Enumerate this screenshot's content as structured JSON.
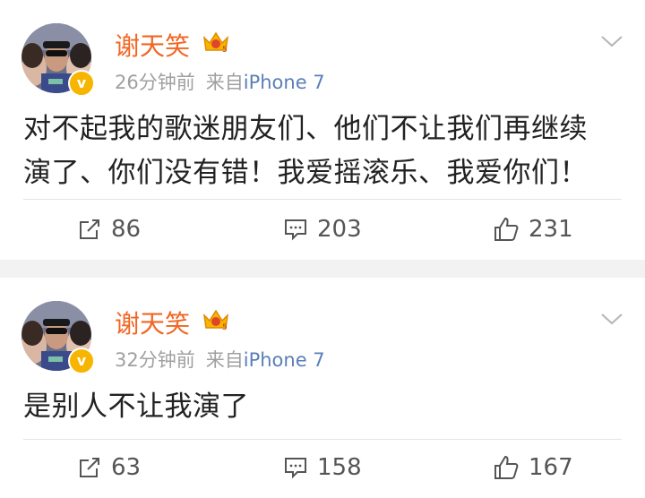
{
  "posts": [
    {
      "user": {
        "name": "谢天笑",
        "verified_badge": "v",
        "crown_badge": "5"
      },
      "time": "26分钟前",
      "source_label": "来自",
      "device": "iPhone 7",
      "text_lines": [
        "对不起我的歌迷朋友们、他们不让我们再继续",
        "演了、你们没有错！我爱摇滚乐、我爱你们！"
      ],
      "actions": {
        "repost": "86",
        "comment": "203",
        "like": "231"
      }
    },
    {
      "user": {
        "name": "谢天笑",
        "verified_badge": "v",
        "crown_badge": "5"
      },
      "time": "32分钟前",
      "source_label": "来自",
      "device": "iPhone 7",
      "text_lines": [
        "是别人不让我演了"
      ],
      "actions": {
        "repost": "63",
        "comment": "158",
        "like": "167"
      }
    }
  ],
  "colors": {
    "username": "#f26522",
    "meta": "#a0a0a0",
    "device_link": "#5b7fb8",
    "verified": "#f7b500",
    "page_bg": "#f2f2f2"
  },
  "icons": {
    "repost": "repost-icon",
    "comment": "comment-icon",
    "like": "thumbs-up-icon",
    "more": "chevron-down-icon"
  }
}
